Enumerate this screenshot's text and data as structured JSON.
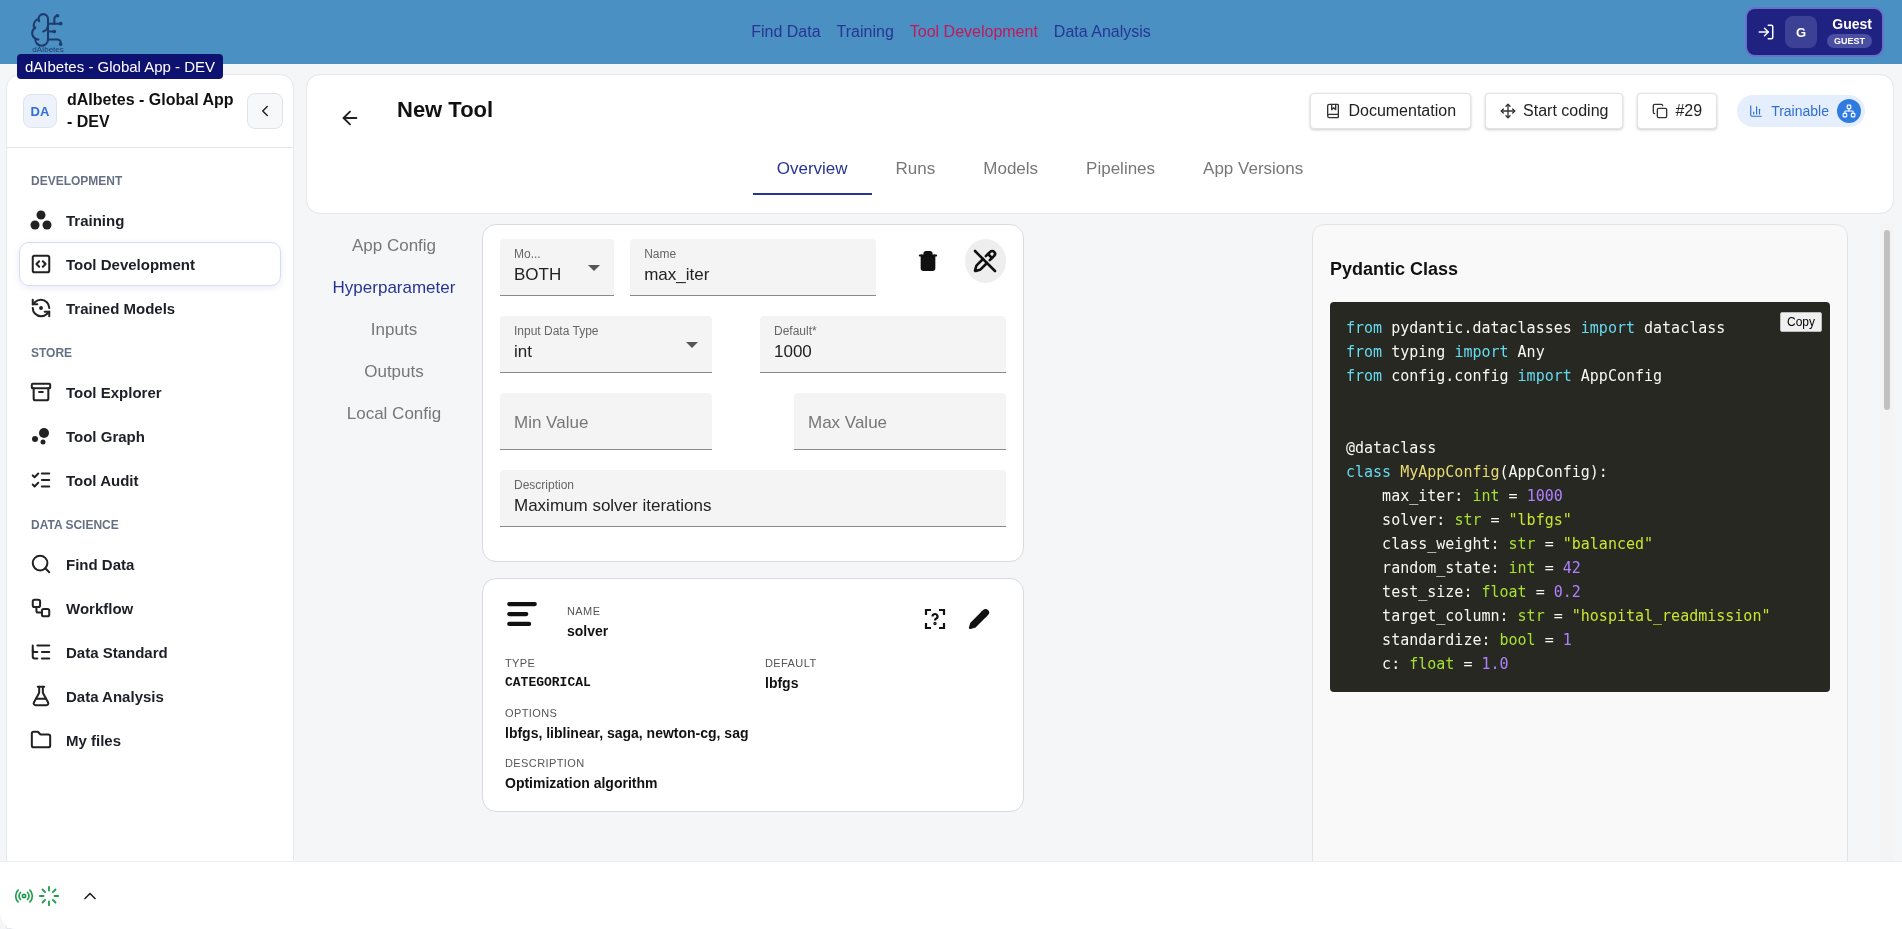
{
  "top_bar": {
    "logo_caption": "dAIbetes",
    "nav": [
      {
        "label": "Find Data",
        "selected": false
      },
      {
        "label": "Training",
        "selected": false
      },
      {
        "label": "Tool Development",
        "selected": true
      },
      {
        "label": "Data Analysis",
        "selected": false
      }
    ],
    "user": {
      "initial": "G",
      "name": "Guest",
      "role": "GUEST"
    }
  },
  "tooltip": "dAIbetes - Global App - DEV",
  "sidebar": {
    "avatar": "DA",
    "title": "dAIbetes - Global App - DEV",
    "sections": [
      {
        "heading": "DEVELOPMENT",
        "items": [
          {
            "label": "Training",
            "selected": false
          },
          {
            "label": "Tool Development",
            "selected": true
          },
          {
            "label": "Trained Models",
            "selected": false
          }
        ]
      },
      {
        "heading": "STORE",
        "items": [
          {
            "label": "Tool Explorer",
            "selected": false
          },
          {
            "label": "Tool Graph",
            "selected": false
          },
          {
            "label": "Tool Audit",
            "selected": false
          }
        ]
      },
      {
        "heading": "DATA SCIENCE",
        "items": [
          {
            "label": "Find Data",
            "selected": false
          },
          {
            "label": "Workflow",
            "selected": false
          },
          {
            "label": "Data Standard",
            "selected": false
          },
          {
            "label": "Data Analysis",
            "selected": false
          },
          {
            "label": "My files",
            "selected": false
          }
        ]
      }
    ]
  },
  "header": {
    "title": "New Tool",
    "buttons": [
      "Documentation",
      "Start coding",
      "#29"
    ],
    "badge": "Trainable",
    "tabs": [
      {
        "label": "Overview",
        "selected": true
      },
      {
        "label": "Runs",
        "selected": false
      },
      {
        "label": "Models",
        "selected": false
      },
      {
        "label": "Pipelines",
        "selected": false
      },
      {
        "label": "App Versions",
        "selected": false
      }
    ]
  },
  "section_nav": [
    {
      "label": "App Config",
      "selected": false
    },
    {
      "label": "Hyperparameter",
      "selected": true
    },
    {
      "label": "Inputs",
      "selected": false
    },
    {
      "label": "Outputs",
      "selected": false
    },
    {
      "label": "Local Config",
      "selected": false
    }
  ],
  "edit_form": {
    "fields": [
      {
        "kind": "select",
        "label": "Mo...",
        "value": "BOTH"
      },
      {
        "kind": "text",
        "label": "Name",
        "value": "max_iter"
      },
      {
        "kind": "select",
        "label": "Input Data Type",
        "value": "int"
      },
      {
        "kind": "text",
        "label": "Default*",
        "value": "1000"
      },
      {
        "kind": "text",
        "placeholder": "Min Value"
      },
      {
        "kind": "text",
        "placeholder": "Max Value"
      },
      {
        "kind": "text",
        "label": "Description",
        "value": "Maximum solver iterations"
      }
    ]
  },
  "parameter_card": {
    "name_label": "NAME",
    "name": "solver",
    "type_label": "TYPE",
    "type": "CATEGORICAL",
    "default_label": "DEFAULT",
    "default": "lbfgs",
    "options_label": "OPTIONS",
    "options": "lbfgs, liblinear, saga, newton-cg, sag",
    "description_label": "DESCRIPTION",
    "description": "Optimization algorithm"
  },
  "code_panel": {
    "title": "Pydantic Class",
    "copy": "Copy",
    "lines": [
      {
        "gap_before": false,
        "tokens": [
          {
            "kind": "keyword",
            "text": "from"
          },
          {
            "kind": "plain",
            "text": " pydantic.dataclasses "
          },
          {
            "kind": "keyword",
            "text": "import"
          },
          {
            "kind": "plain",
            "text": " dataclass"
          }
        ]
      },
      {
        "gap_before": false,
        "tokens": [
          {
            "kind": "keyword",
            "text": "from"
          },
          {
            "kind": "plain",
            "text": " typing "
          },
          {
            "kind": "keyword",
            "text": "import"
          },
          {
            "kind": "plain",
            "text": " Any"
          }
        ]
      },
      {
        "gap_before": false,
        "tokens": [
          {
            "kind": "keyword",
            "text": "from"
          },
          {
            "kind": "plain",
            "text": " config.config "
          },
          {
            "kind": "keyword",
            "text": "import"
          },
          {
            "kind": "plain",
            "text": " AppConfig"
          }
        ]
      },
      {
        "gap_before": true,
        "tokens": [
          {
            "kind": "plain",
            "text": "@dataclass"
          }
        ]
      },
      {
        "gap_before": false,
        "tokens": [
          {
            "kind": "keyword",
            "text": "class "
          },
          {
            "kind": "classname",
            "text": "MyAppConfig"
          },
          {
            "kind": "plain",
            "text": "(AppConfig):"
          }
        ]
      },
      {
        "gap_before": false,
        "tokens": [
          {
            "kind": "plain",
            "text": "    max_iter: "
          },
          {
            "kind": "type",
            "text": "int"
          },
          {
            "kind": "plain",
            "text": " = "
          },
          {
            "kind": "number",
            "text": "1000"
          }
        ]
      },
      {
        "gap_before": false,
        "tokens": [
          {
            "kind": "plain",
            "text": "    solver: "
          },
          {
            "kind": "type",
            "text": "str"
          },
          {
            "kind": "plain",
            "text": " = "
          },
          {
            "kind": "string",
            "text": "\"lbfgs\""
          }
        ]
      },
      {
        "gap_before": false,
        "tokens": [
          {
            "kind": "plain",
            "text": "    class_weight: "
          },
          {
            "kind": "type",
            "text": "str"
          },
          {
            "kind": "plain",
            "text": " = "
          },
          {
            "kind": "string",
            "text": "\"balanced\""
          }
        ]
      },
      {
        "gap_before": false,
        "tokens": [
          {
            "kind": "plain",
            "text": "    random_state: "
          },
          {
            "kind": "type",
            "text": "int"
          },
          {
            "kind": "plain",
            "text": " = "
          },
          {
            "kind": "number",
            "text": "42"
          }
        ]
      },
      {
        "gap_before": false,
        "tokens": [
          {
            "kind": "plain",
            "text": "    test_size: "
          },
          {
            "kind": "type",
            "text": "float"
          },
          {
            "kind": "plain",
            "text": " = "
          },
          {
            "kind": "number",
            "text": "0.2"
          }
        ]
      },
      {
        "gap_before": false,
        "tokens": [
          {
            "kind": "plain",
            "text": "    target_column: "
          },
          {
            "kind": "type",
            "text": "str"
          },
          {
            "kind": "plain",
            "text": " = "
          },
          {
            "kind": "string",
            "text": "\"hospital_readmission\""
          }
        ]
      },
      {
        "gap_before": false,
        "tokens": [
          {
            "kind": "plain",
            "text": "    standardize: "
          },
          {
            "kind": "type",
            "text": "bool"
          },
          {
            "kind": "plain",
            "text": " = "
          },
          {
            "kind": "number",
            "text": "1"
          }
        ]
      },
      {
        "gap_before": false,
        "tokens": [
          {
            "kind": "plain",
            "text": "    c: "
          },
          {
            "kind": "type",
            "text": "float"
          },
          {
            "kind": "plain",
            "text": " = "
          },
          {
            "kind": "number",
            "text": "1.0"
          }
        ]
      }
    ]
  }
}
